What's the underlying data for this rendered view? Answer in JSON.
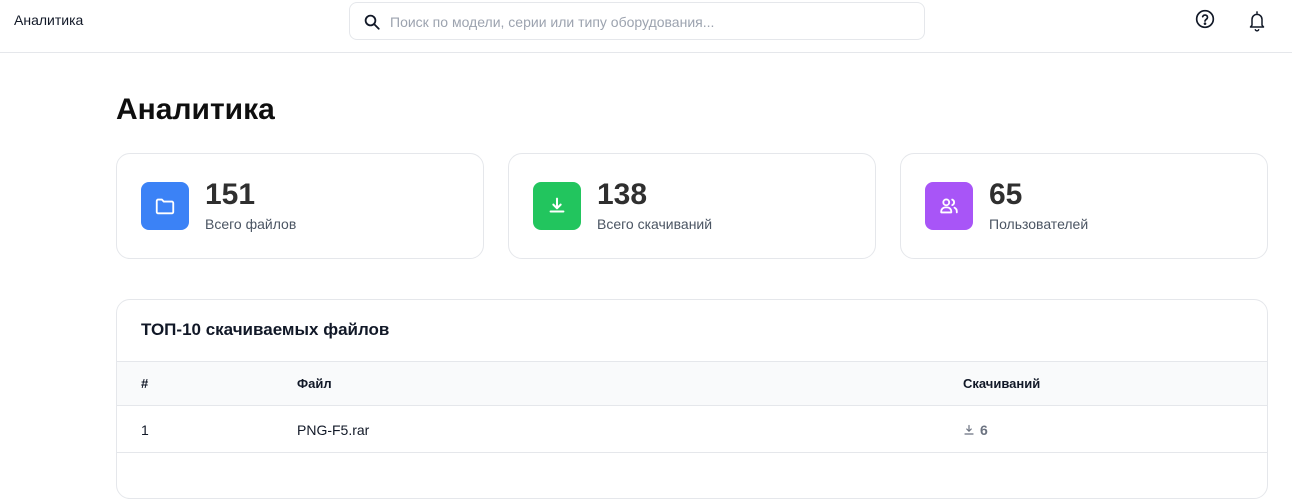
{
  "header": {
    "app_title": "Аналитика",
    "search_placeholder": "Поиск по модели, серии или типу оборудования..."
  },
  "page": {
    "title": "Аналитика"
  },
  "stats": [
    {
      "value": "151",
      "label": "Всего файлов",
      "icon": "folder-icon",
      "color": "#3b82f6"
    },
    {
      "value": "138",
      "label": "Всего скачиваний",
      "icon": "download-icon",
      "color": "#22c55e"
    },
    {
      "value": "65",
      "label": "Пользователей",
      "icon": "users-icon",
      "color": "#a855f7"
    }
  ],
  "top_files": {
    "title": "ТОП-10 скачиваемых файлов",
    "columns": [
      "#",
      "Файл",
      "Скачиваний"
    ],
    "rows": [
      {
        "num": "1",
        "file": "PNG-F5.rar",
        "downloads": "6"
      }
    ]
  }
}
